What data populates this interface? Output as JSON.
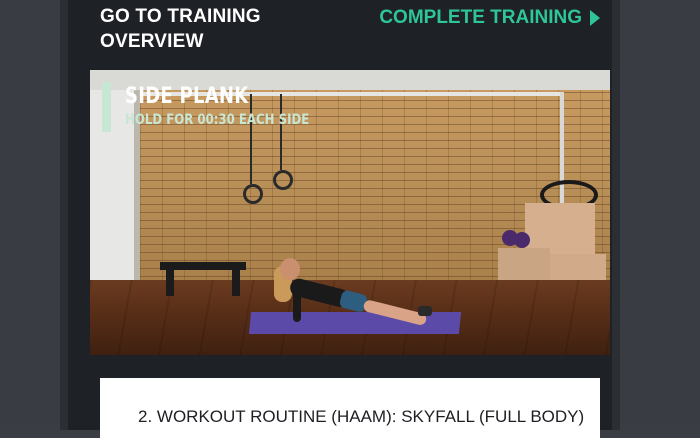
{
  "header": {
    "back_label": "GO TO TRAINING OVERVIEW",
    "complete_label": "COMPLETE TRAINING",
    "complete_icon": "play-arrow-icon",
    "accent_color": "#2ec59b"
  },
  "video": {
    "exercise_title": "SIDE PLANK",
    "exercise_instruction": "HOLD FOR 00:30 EACH SIDE",
    "overlay_accent_color": "#c8e6d4"
  },
  "workout": {
    "title": "2. WORKOUT ROUTINE (HAAM): SKYFALL (FULL BODY)"
  }
}
